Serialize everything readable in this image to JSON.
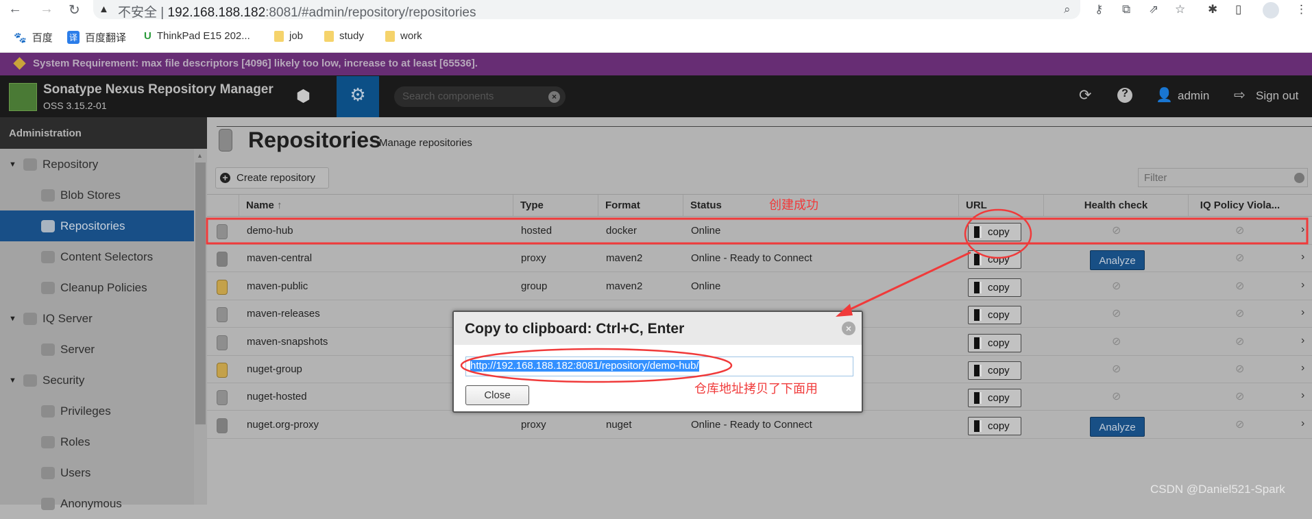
{
  "browser": {
    "url_insecure_label": "不安全",
    "url_host": "192.168.188.182",
    "url_rest": ":8081/#admin/repository/repositories",
    "bookmarks": [
      {
        "label": "百度",
        "icon": "baidu-icon"
      },
      {
        "label": "百度翻译",
        "icon": "translate-icon"
      },
      {
        "label": "ThinkPad E15 202...",
        "icon": "lenovo-icon"
      },
      {
        "label": "job",
        "icon": "folder-icon"
      },
      {
        "label": "study",
        "icon": "folder-icon"
      },
      {
        "label": "work",
        "icon": "folder-icon"
      }
    ]
  },
  "banner": {
    "text": "System Requirement: max file descriptors [4096] likely too low, increase to at least [65536].",
    "color": "#672d74"
  },
  "header": {
    "product": "Sonatype Nexus Repository Manager",
    "version": "OSS 3.15.2-01",
    "search_placeholder": "Search components",
    "user": "admin",
    "signout": "Sign out"
  },
  "sidebar": {
    "title": "Administration",
    "items": [
      {
        "label": "Repository",
        "level": 0,
        "icon": "database-icon"
      },
      {
        "label": "Blob Stores",
        "level": 1,
        "icon": "blob-store-icon"
      },
      {
        "label": "Repositories",
        "level": 1,
        "icon": "database-icon",
        "selected": true
      },
      {
        "label": "Content Selectors",
        "level": 1,
        "icon": "content-selector-icon"
      },
      {
        "label": "Cleanup Policies",
        "level": 1,
        "icon": "broom-icon"
      },
      {
        "label": "IQ Server",
        "level": 0,
        "icon": "iq-server-icon"
      },
      {
        "label": "Server",
        "level": 1,
        "icon": "server-icon"
      },
      {
        "label": "Security",
        "level": 0,
        "icon": "security-icon"
      },
      {
        "label": "Privileges",
        "level": 1,
        "icon": "medal-icon"
      },
      {
        "label": "Roles",
        "level": 1,
        "icon": "role-icon"
      },
      {
        "label": "Users",
        "level": 1,
        "icon": "users-icon"
      },
      {
        "label": "Anonymous",
        "level": 1,
        "icon": "anonymous-icon"
      }
    ]
  },
  "page": {
    "title": "Repositories",
    "subtitle": "Manage repositories",
    "create_button": "Create repository",
    "filter_placeholder": "Filter"
  },
  "table": {
    "columns": [
      "Name",
      "Type",
      "Format",
      "Status",
      "URL",
      "Health check",
      "IQ Policy Viola..."
    ],
    "copy_label": "copy",
    "analyze_label": "Analyze",
    "rows": [
      {
        "name": "demo-hub",
        "type": "hosted",
        "format": "docker",
        "status": "Online",
        "kind": "hosted",
        "health": "none"
      },
      {
        "name": "maven-central",
        "type": "proxy",
        "format": "maven2",
        "status": "Online - Ready to Connect",
        "kind": "proxy",
        "health": "analyze"
      },
      {
        "name": "maven-public",
        "type": "group",
        "format": "maven2",
        "status": "Online",
        "kind": "group",
        "health": "none"
      },
      {
        "name": "maven-releases",
        "type": "",
        "format": "",
        "status": "",
        "kind": "hosted",
        "health": "none"
      },
      {
        "name": "maven-snapshots",
        "type": "",
        "format": "",
        "status": "",
        "kind": "hosted",
        "health": "none"
      },
      {
        "name": "nuget-group",
        "type": "",
        "format": "",
        "status": "",
        "kind": "group",
        "health": "none"
      },
      {
        "name": "nuget-hosted",
        "type": "",
        "format": "",
        "status": "",
        "kind": "hosted",
        "health": "none"
      },
      {
        "name": "nuget.org-proxy",
        "type": "proxy",
        "format": "nuget",
        "status": "Online - Ready to Connect",
        "kind": "proxy",
        "health": "analyze"
      }
    ]
  },
  "dialog": {
    "title": "Copy to clipboard: Ctrl+C, Enter",
    "url": "http://192.168.188.182:8081/repository/demo-hub/",
    "close_button": "Close"
  },
  "annotations": {
    "created": "创建成功",
    "copied_note": "仓库地址拷贝了下面用",
    "color": "#f03a3a"
  },
  "watermark": "CSDN @Daniel521-Spark"
}
